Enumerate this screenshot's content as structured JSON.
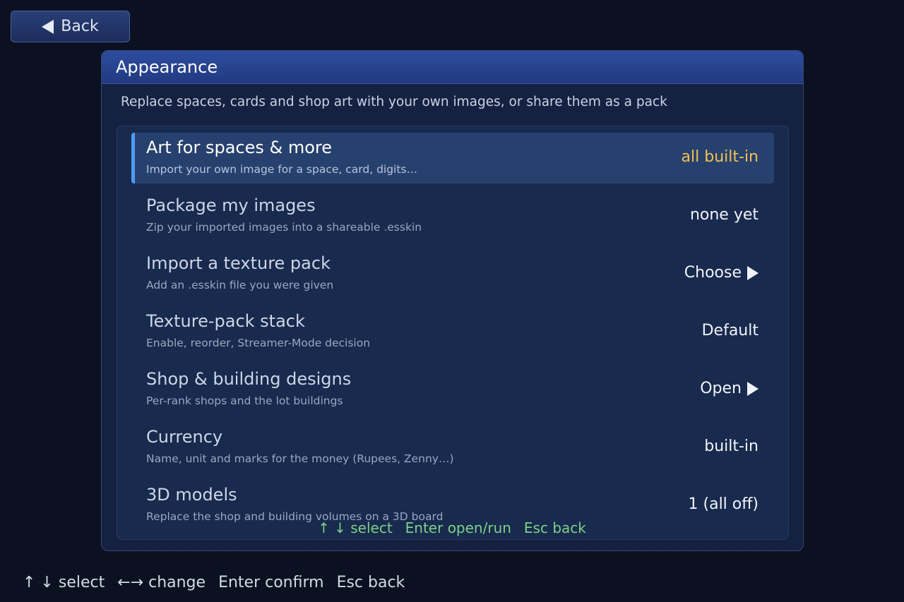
{
  "back_button": {
    "label": "Back"
  },
  "panel": {
    "title": "Appearance",
    "subtitle": "Replace spaces, cards and shop art with your own images, or share them as a pack"
  },
  "rows": [
    {
      "title": "Art for spaces & more",
      "desc": "Import your own image for a space, card, digits…",
      "value": "all built-in",
      "arrow": false
    },
    {
      "title": "Package my images",
      "desc": "Zip your imported images into a shareable .esskin",
      "value": "none yet",
      "arrow": false
    },
    {
      "title": "Import a texture pack",
      "desc": "Add an .esskin file you were given",
      "value": "Choose",
      "arrow": true
    },
    {
      "title": "Texture-pack stack",
      "desc": "Enable, reorder, Streamer-Mode decision",
      "value": "Default",
      "arrow": false
    },
    {
      "title": "Shop & building designs",
      "desc": "Per-rank shops and the lot buildings",
      "value": "Open",
      "arrow": true
    },
    {
      "title": "Currency",
      "desc": "Name, unit and marks for the money (Rupees, Zenny…)",
      "value": "built-in",
      "arrow": false
    },
    {
      "title": "3D models",
      "desc": "Replace the shop and building volumes on a 3D board",
      "value": "1 (all off)",
      "arrow": false
    }
  ],
  "inner_hints": [
    "↑ ↓  select",
    "Enter open/run",
    "Esc back"
  ],
  "bottom_hints": [
    "↑ ↓  select",
    "←→ change",
    "Enter confirm",
    "Esc back"
  ],
  "colors": {
    "accent": "#4e9cf2",
    "selected_value": "#f2c14e",
    "hint_green": "#7ed08a"
  }
}
